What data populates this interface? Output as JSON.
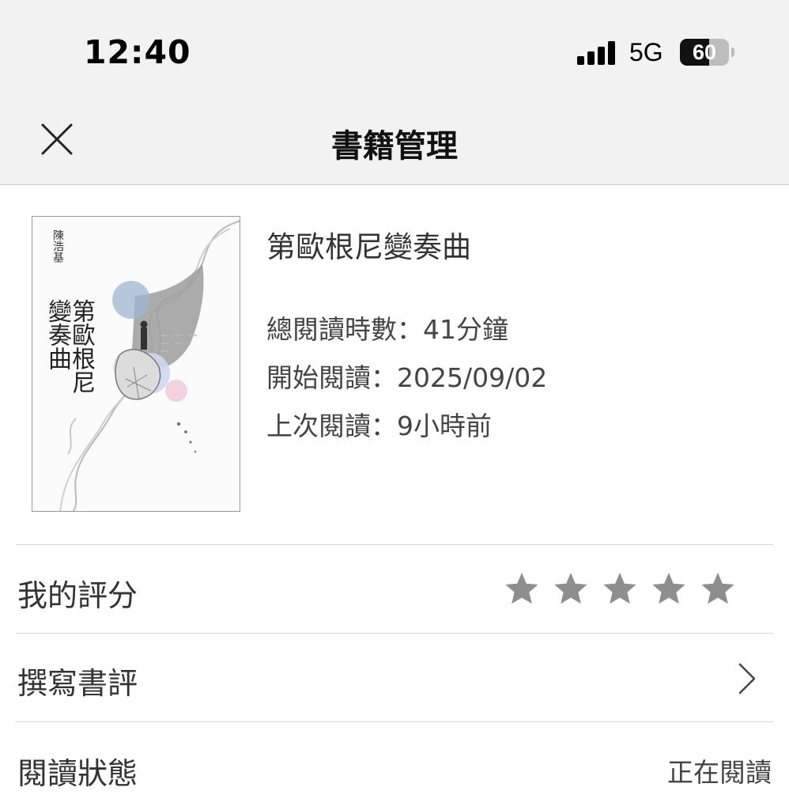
{
  "status_bar": {
    "time": "12:40",
    "network": "5G",
    "battery": "60",
    "battery_level": 0.6
  },
  "header": {
    "title": "書籍管理",
    "close_icon": "close-icon"
  },
  "book": {
    "title": "第歐根尼變奏曲",
    "cover": {
      "author": "陳浩基",
      "title": "第歐根尼變奏曲"
    },
    "stats": {
      "total_reading_time": "總閱讀時數：41分鐘",
      "start_reading": "開始閱讀：2025/09/02",
      "last_read": "上次閱讀：9小時前"
    }
  },
  "rating": {
    "label": "我的評分",
    "value": 0,
    "max": 5,
    "icon": "star-icon"
  },
  "review": {
    "label": "撰寫書評",
    "icon": "chevron-right-icon"
  },
  "reading_status": {
    "label": "閱讀狀態",
    "value": "正在閱讀"
  },
  "colors": {
    "header_bg": "#f2f2f2",
    "divider": "#d6d6d6",
    "star": "#8e8e8e"
  }
}
